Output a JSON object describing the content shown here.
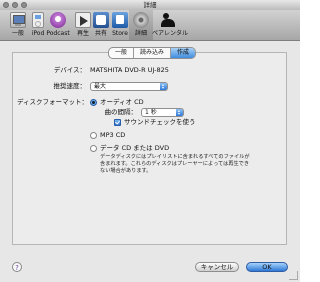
{
  "window": {
    "title": "詳細"
  },
  "toolbar": {
    "items": [
      {
        "label": "一般",
        "icon": "general-icon"
      },
      {
        "label": "iPod",
        "icon": "ipod-icon"
      },
      {
        "label": "Podcast",
        "icon": "podcast-icon"
      },
      {
        "label": "再生",
        "icon": "play-icon"
      },
      {
        "label": "共有",
        "icon": "share-icon"
      },
      {
        "label": "Store",
        "icon": "store-icon"
      },
      {
        "label": "詳細",
        "icon": "gear-icon",
        "selected": true
      },
      {
        "label": "ペアレンタル",
        "icon": "parental-icon"
      }
    ]
  },
  "tabs": [
    {
      "label": "一般"
    },
    {
      "label": "読み込み"
    },
    {
      "label": "作成",
      "active": true
    }
  ],
  "device": {
    "label": "デバイス：",
    "value": "MATSHITA DVD-R   UJ-825"
  },
  "speed": {
    "label": "推奨速度：",
    "value": "最大"
  },
  "format": {
    "label": "ディスクフォーマット：",
    "audio_cd": "オーディオ CD",
    "gap_label": "曲の間隔：",
    "gap_value": "1 秒",
    "soundcheck": "サウンドチェックを使う",
    "mp3_cd": "MP3 CD",
    "data_cd": "データ CD または DVD",
    "data_desc": "データディスクにはプレイリストに含まれるすべてのファイルが含まれます。これらのディスクはプレーヤーによっては再生できない場合があります。"
  },
  "buttons": {
    "help": "?",
    "cancel": "キャンセル",
    "ok": "OK"
  }
}
